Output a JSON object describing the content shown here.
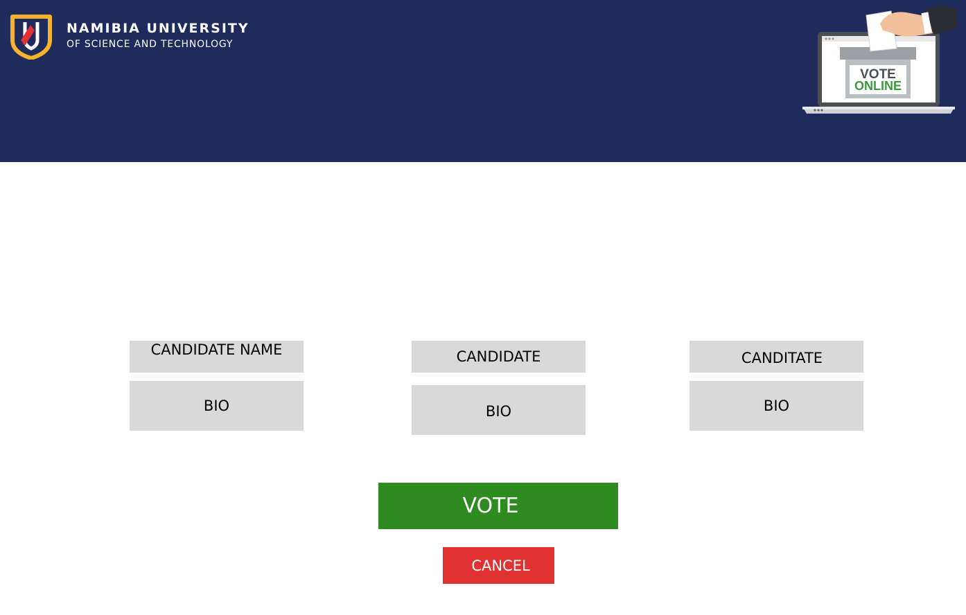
{
  "header": {
    "logo_line1": "NAMIBIA UNIVERSITY",
    "logo_line2": "OF SCIENCE AND TECHNOLOGY",
    "illustration": {
      "line1": "VOTE",
      "line2": "ONLINE"
    }
  },
  "candidates": [
    {
      "name": "CANDIDATE NAME",
      "bio": "BIO"
    },
    {
      "name": "CANDIDATE",
      "bio": "BIO"
    },
    {
      "name": "CANDITATE",
      "bio": "BIO"
    }
  ],
  "actions": {
    "vote_label": "VOTE",
    "cancel_label": "CANCEL"
  },
  "colors": {
    "header_bg": "#1e2b5c",
    "box_bg": "#d9d9d9",
    "vote_bg": "#2e8b1f",
    "cancel_bg": "#e03133",
    "logo_gold": "#f4b22d",
    "logo_red": "#e03133",
    "online_green": "#3a9a3a"
  }
}
